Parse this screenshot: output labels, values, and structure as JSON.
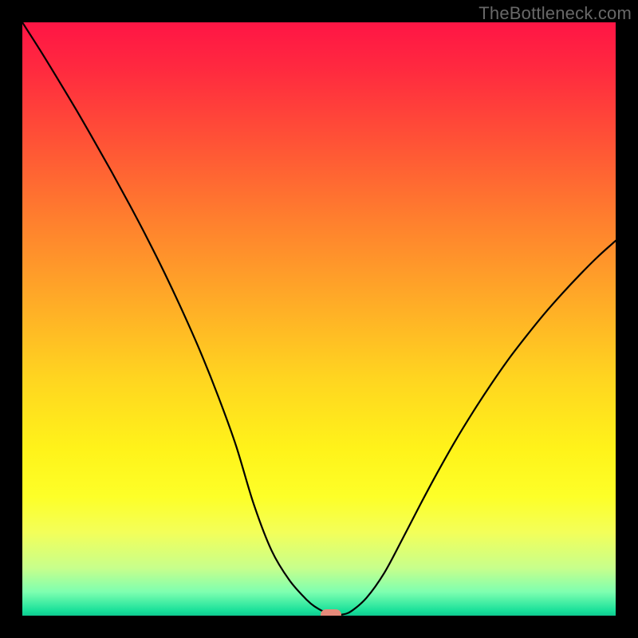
{
  "watermark": "TheBottleneck.com",
  "chart_data": {
    "type": "line",
    "title": "",
    "xlabel": "",
    "ylabel": "",
    "xlim": [
      0,
      100
    ],
    "ylim": [
      0,
      100
    ],
    "x": [
      0,
      3,
      6,
      9,
      12,
      15,
      18,
      21,
      24,
      27,
      30,
      33,
      36,
      39,
      42,
      45,
      48,
      49.5,
      51,
      52.5,
      54,
      55.5,
      58,
      61,
      64,
      67,
      70,
      73,
      76,
      79,
      82,
      85,
      88,
      91,
      94,
      97,
      100
    ],
    "values": [
      100,
      95.3,
      90.4,
      85.4,
      80.2,
      74.9,
      69.4,
      63.7,
      57.7,
      51.3,
      44.5,
      37.0,
      28.7,
      18.8,
      11.0,
      6.0,
      2.6,
      1.4,
      0.6,
      0.2,
      0.2,
      0.8,
      3.0,
      7.2,
      12.8,
      18.6,
      24.2,
      29.5,
      34.4,
      39.0,
      43.3,
      47.2,
      50.9,
      54.3,
      57.5,
      60.5,
      63.2
    ],
    "marker": {
      "x": 52,
      "y": 0.2
    },
    "gradient": {
      "stops": [
        {
          "pos": 0,
          "color": "#ff1545"
        },
        {
          "pos": 8,
          "color": "#ff2a3f"
        },
        {
          "pos": 20,
          "color": "#ff5236"
        },
        {
          "pos": 33,
          "color": "#ff7e2e"
        },
        {
          "pos": 47,
          "color": "#ffab27"
        },
        {
          "pos": 60,
          "color": "#ffd520"
        },
        {
          "pos": 72,
          "color": "#fff31a"
        },
        {
          "pos": 80,
          "color": "#fdff28"
        },
        {
          "pos": 86,
          "color": "#f3ff5a"
        },
        {
          "pos": 92,
          "color": "#c7ff8c"
        },
        {
          "pos": 96,
          "color": "#7effb0"
        },
        {
          "pos": 99.2,
          "color": "#18e09a"
        },
        {
          "pos": 100,
          "color": "#0fc98f"
        }
      ]
    }
  }
}
